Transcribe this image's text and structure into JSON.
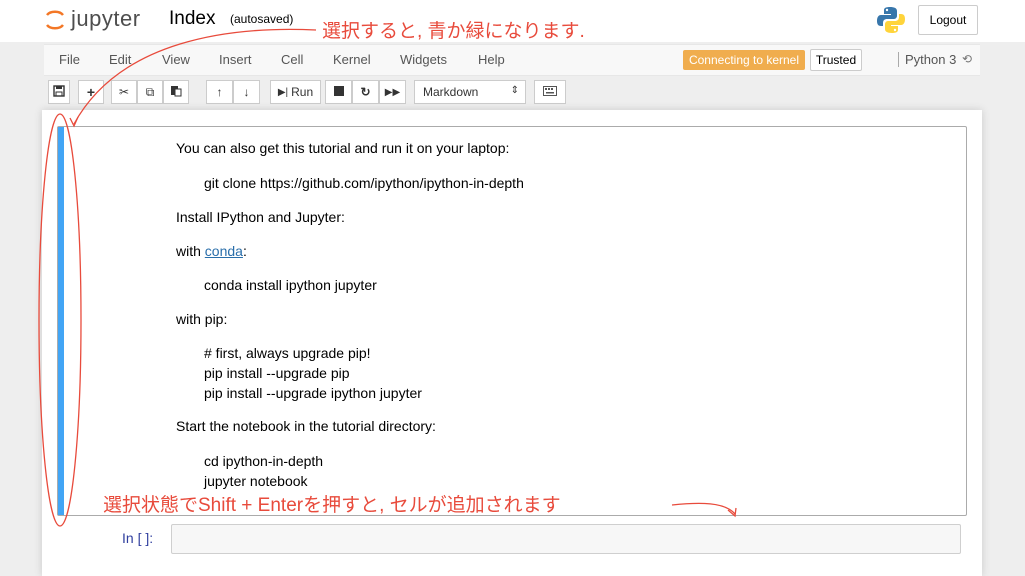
{
  "header": {
    "logo_text": "jupyter",
    "notebook_name": "Index",
    "autosave_status": "(autosaved)",
    "logout_label": "Logout"
  },
  "menubar": {
    "items": [
      "File",
      "Edit",
      "View",
      "Insert",
      "Cell",
      "Kernel",
      "Widgets",
      "Help"
    ],
    "kernel_status": "Connecting to kernel",
    "trusted_label": "Trusted",
    "kernel_name": "Python 3",
    "kernel_status_color": "#f0ad4e"
  },
  "toolbar": {
    "icons": [
      "save-icon",
      "plus-icon",
      "cut-icon",
      "copy-icon",
      "paste-icon",
      "arrow-up-icon",
      "arrow-down-icon"
    ],
    "run_label": "Run",
    "cell_type": "Markdown"
  },
  "cell": {
    "p1": "You can also get this tutorial and run it on your laptop:",
    "code1": "git clone https://github.com/ipython/ipython-in-depth",
    "p2": "Install IPython and Jupyter:",
    "p3_prefix": "with ",
    "p3_link": "conda",
    "p3_suffix": ":",
    "code2": "conda install ipython jupyter",
    "p4": "with pip:",
    "code3_line1": "# first, always upgrade pip!",
    "code3_line2": "pip install --upgrade pip",
    "code3_line3": "pip install --upgrade ipython jupyter",
    "p5": "Start the notebook in the tutorial directory:",
    "code4_line1": "cd ipython-in-depth",
    "code4_line2": "jupyter notebook",
    "selected_bar_color": "#42a5f5"
  },
  "next_cell": {
    "prompt": "In [ ]:"
  },
  "annotations": {
    "top": "選択すると, 青か緑になります.",
    "bottom": "選択状態でShift + Enterを押すと, セルが追加されます",
    "color": "#e84b3c"
  }
}
